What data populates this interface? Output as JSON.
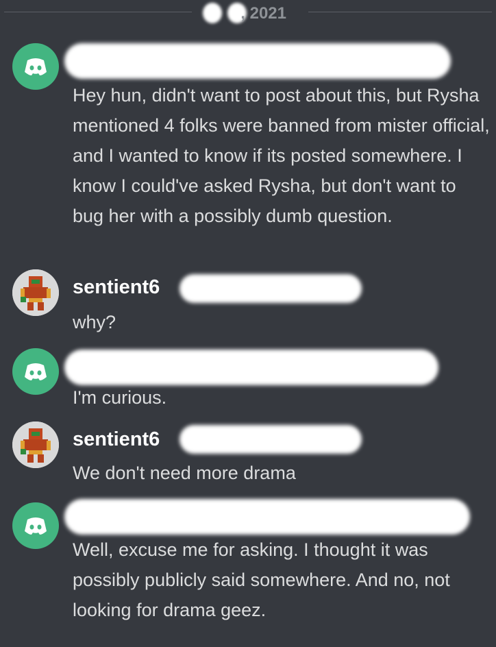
{
  "divider": {
    "date_text": ", 2021"
  },
  "messages": [
    {
      "author": "",
      "avatar": "discord-default-avatar",
      "text": "Hey hun, didn't want to post about this, but Rysha mentioned 4 folks were banned from mister official, and I wanted to know if its posted somewhere. I know I could've asked Rysha, but don't want to bug her with a possibly dumb question."
    },
    {
      "author": "sentient6",
      "avatar": "samus-pixel-avatar",
      "text": "why?"
    },
    {
      "author": "",
      "avatar": "discord-default-avatar",
      "text": "I'm curious."
    },
    {
      "author": "sentient6",
      "avatar": "samus-pixel-avatar",
      "text": "We don't need more drama"
    },
    {
      "author": "",
      "avatar": "discord-default-avatar",
      "text": "Well, excuse me for asking. I thought it was possibly publicly said somewhere. And no, not looking for drama geez."
    }
  ],
  "colors": {
    "background": "#36393f",
    "discord_green": "#43b581",
    "text": "#dcddde",
    "muted": "#8e9297"
  }
}
